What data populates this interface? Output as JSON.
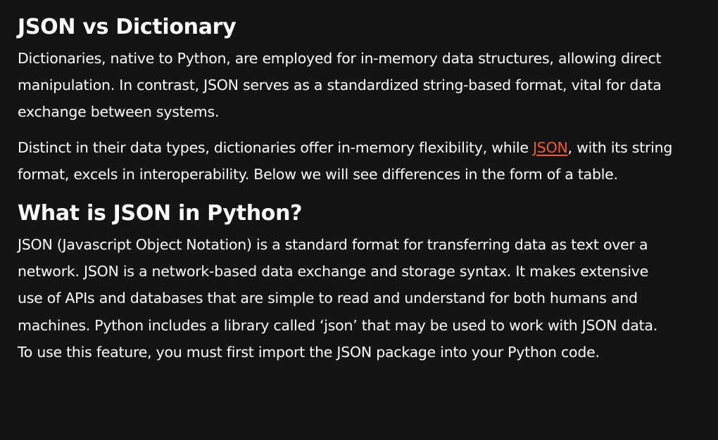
{
  "sections": [
    {
      "heading": "JSON vs Dictionary",
      "p1": "Dictionaries, native to Python, are employed for in-memory data structures, allowing direct manipulation. In contrast, JSON serves as a standardized string-based format, vital for data exchange between systems.",
      "p2_before": "Distinct in their data types, dictionaries offer in-memory flexibility, while ",
      "p2_link": "JSON",
      "p2_after": ", with its string format, excels in interoperability. Below we will see differences in the form of a table."
    },
    {
      "heading": "What is JSON in Python?",
      "p1": "JSON (Javascript Object Notation) is a standard format for transferring data as text over a network. JSON is a network-based data exchange and storage syntax. It makes extensive use of APIs and databases that are simple to read and understand for both humans and machines. Python includes a library called ‘json’ that may be used to work with JSON data. To use this feature, you must first import the JSON package into your Python code."
    }
  ],
  "colors": {
    "background": "#141416",
    "text": "#ffffff",
    "link": "#f25c2b"
  }
}
